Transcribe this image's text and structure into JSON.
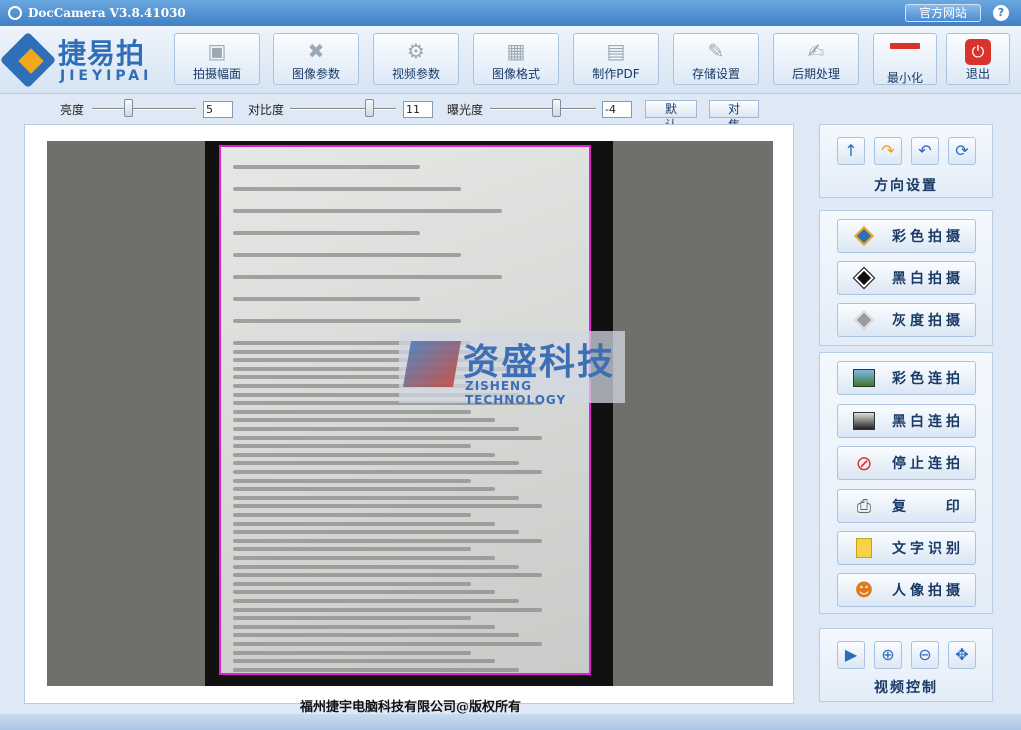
{
  "window": {
    "title": "DocCamera V3.8.41030",
    "site_button": "官方网站",
    "help": "?"
  },
  "logo": {
    "cn": "捷易拍",
    "en": "JIEYIPAI"
  },
  "toolbar": {
    "buttons": [
      {
        "label": "拍摄幅面",
        "icon": "camera-icon"
      },
      {
        "label": "图像参数",
        "icon": "tools-icon"
      },
      {
        "label": "视频参数",
        "icon": "gears-icon"
      },
      {
        "label": "图像格式",
        "icon": "image-format-icon"
      },
      {
        "label": "制作PDF",
        "icon": "pdf-icon"
      },
      {
        "label": "存储设置",
        "icon": "storage-icon"
      },
      {
        "label": "后期处理",
        "icon": "post-process-icon"
      },
      {
        "label": "最小化",
        "icon": "minimize-icon"
      },
      {
        "label": "退出",
        "icon": "power-icon"
      }
    ]
  },
  "sliders": {
    "brightness": {
      "label": "亮度",
      "value": "5",
      "level": 0.25
    },
    "contrast": {
      "label": "对比度",
      "value": "11",
      "level": 0.75
    },
    "exposure": {
      "label": "曝光度",
      "value": "-4",
      "level": 0.6
    },
    "default_button": "默 认",
    "focus_button": "对 焦"
  },
  "watermark": {
    "cn": "资盛科技",
    "en": "ZISHENG TECHNOLOGY"
  },
  "footer": "福州捷宇电脑科技有限公司@版权所有",
  "direction": {
    "title": "方向设置",
    "icons": [
      "arrow-up-icon",
      "rotate-right-icon",
      "rotate-left-icon",
      "rotate-refresh-icon"
    ]
  },
  "capture": {
    "buttons": [
      {
        "label": "彩色拍摄",
        "icon": "color-capture-icon"
      },
      {
        "label": "黑白拍摄",
        "icon": "bw-capture-icon"
      },
      {
        "label": "灰度拍摄",
        "icon": "gray-capture-icon"
      }
    ]
  },
  "continuous": {
    "buttons": [
      {
        "label": "彩色连拍",
        "icon": "color-burst-icon"
      },
      {
        "label": "黑白连拍",
        "icon": "bw-burst-icon"
      },
      {
        "label": "停止连拍",
        "icon": "stop-icon"
      },
      {
        "label": "复  印",
        "icon": "printer-icon"
      },
      {
        "label": "文字识别",
        "icon": "ocr-icon"
      },
      {
        "label": "人像拍摄",
        "icon": "portrait-icon"
      }
    ]
  },
  "video": {
    "title": "视频控制",
    "icons": [
      "video-camera-icon",
      "zoom-in-icon",
      "zoom-out-icon",
      "fit-screen-icon"
    ]
  },
  "colors": {
    "accent": "#2f6fb8",
    "border_crop": "#e020d0",
    "exit_red": "#d9342b"
  }
}
